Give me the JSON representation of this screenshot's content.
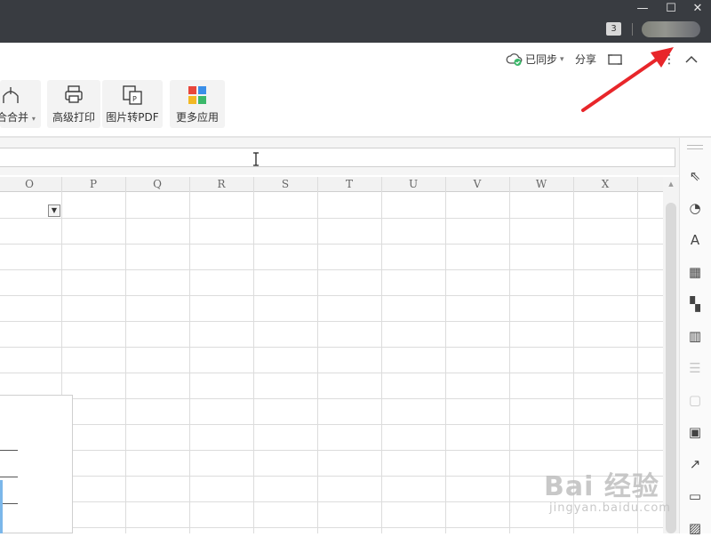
{
  "titlebar": {
    "tab_count": "3",
    "minimize_glyph": "—",
    "maximize_glyph": "☐",
    "close_glyph": "✕"
  },
  "ribbon_top": {
    "sync_status": "已同步",
    "sync_caret": "▾",
    "share_label": "分享",
    "more_glyph": "⋮",
    "collapse_glyph": "︿"
  },
  "ribbon": {
    "merge_label": "合合并",
    "merge_caret": "▾",
    "advanced_print_label": "高级打印",
    "image_to_pdf_label": "图片转PDF",
    "more_apps_label": "更多应用"
  },
  "columns": [
    "O",
    "P",
    "Q",
    "R",
    "S",
    "T",
    "U",
    "V",
    "W",
    "X"
  ],
  "sidepanel": {
    "icons": [
      "select-icon",
      "shapes-icon",
      "font-color-icon",
      "table-icon",
      "apps-grid-icon",
      "bar-chart-icon",
      "filter-settings-icon",
      "comment-icon",
      "image-gallery-icon",
      "share-export-icon",
      "archive-icon",
      "picture-icon"
    ]
  },
  "watermark": {
    "main": "Bai 经验",
    "sub": "jingyan.baidu.com"
  },
  "colors": {
    "titlebar": "#393c41",
    "annotation_arrow": "#e8262a",
    "sync_ok": "#3bb86a",
    "selection": "#7bb7ea"
  }
}
